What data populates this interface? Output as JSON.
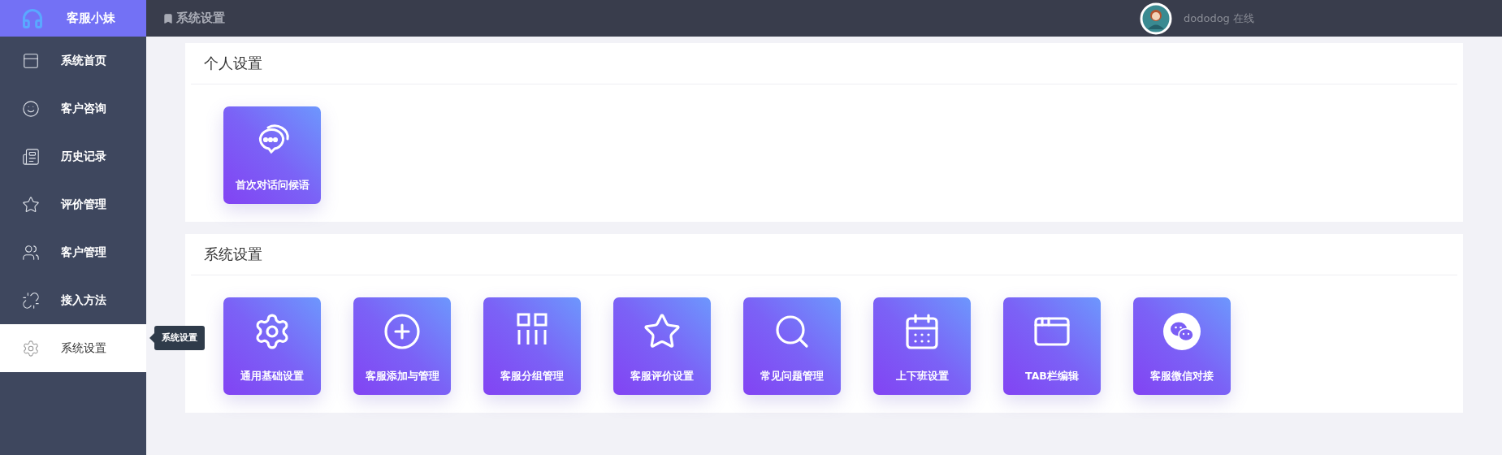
{
  "sidebar": {
    "brand": "客服小妹",
    "items": [
      {
        "label": "系统首页",
        "kind": "window",
        "selected": false
      },
      {
        "label": "客户咨询",
        "kind": "smile",
        "selected": false
      },
      {
        "label": "历史记录",
        "kind": "record",
        "selected": false
      },
      {
        "label": "评价管理",
        "kind": "star",
        "selected": false
      },
      {
        "label": "客户管理",
        "kind": "users",
        "selected": false
      },
      {
        "label": "接入方法",
        "kind": "link",
        "selected": false
      },
      {
        "label": "系统设置",
        "kind": "gear",
        "selected": true
      }
    ]
  },
  "tooltip": "系统设置",
  "header": {
    "title": "系统设置",
    "user": "dododog 在线"
  },
  "sections": [
    {
      "title": "个人设置",
      "tiles": [
        {
          "label": "首次对话问候语",
          "kind": "chat"
        }
      ]
    },
    {
      "title": "系统设置",
      "tiles": [
        {
          "label": "通用基础设置",
          "kind": "gear"
        },
        {
          "label": "客服添加与管理",
          "kind": "plus"
        },
        {
          "label": "客服分组管理",
          "kind": "group"
        },
        {
          "label": "客服评价设置",
          "kind": "star"
        },
        {
          "label": "常见问题管理",
          "kind": "search"
        },
        {
          "label": "上下班设置",
          "kind": "calendar"
        },
        {
          "label": "TAB栏编辑",
          "kind": "window"
        },
        {
          "label": "客服微信对接",
          "kind": "wechat"
        }
      ]
    }
  ]
}
